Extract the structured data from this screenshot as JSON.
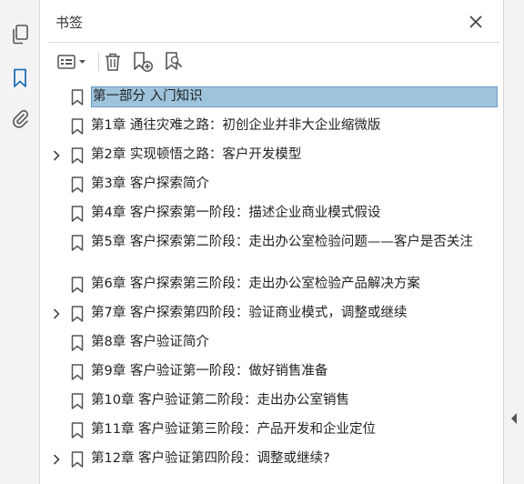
{
  "panel": {
    "title": "书签",
    "close_icon": "close-icon"
  },
  "rail": {
    "items": [
      {
        "name": "pages-icon",
        "active": false
      },
      {
        "name": "bookmark-icon",
        "active": true
      },
      {
        "name": "attachment-icon",
        "active": false
      }
    ]
  },
  "toolbar": {
    "buttons": [
      "options-menu-icon",
      "delete-icon",
      "new-bookmark-icon",
      "bookmark-search-icon"
    ]
  },
  "colors": {
    "accent": "#1f6fb5",
    "selected_bg": "#9ec3dc",
    "selected_border": "#6b9cc0"
  },
  "bookmarks": [
    {
      "label": "第一部分  入门知识",
      "expandable": false,
      "selected": true
    },
    {
      "label": "第1章  通往灾难之路：初创企业并非大企业缩微版",
      "expandable": false,
      "selected": false
    },
    {
      "label": "第2章  实现顿悟之路：客户开发模型",
      "expandable": true,
      "selected": false
    },
    {
      "label": "第3章  客户探索简介",
      "expandable": false,
      "selected": false
    },
    {
      "label": "第4章  客户探索第一阶段：描述企业商业模式假设",
      "expandable": false,
      "selected": false
    },
    {
      "label": "第5章  客户探索第二阶段：走出办公室检验问题——客户是否关注",
      "expandable": false,
      "selected": false
    },
    {
      "label": "第6章  客户探索第三阶段：走出办公室检验产品解决方案",
      "expandable": false,
      "selected": false
    },
    {
      "label": "第7章  客户探索第四阶段：验证商业模式，调整或继续",
      "expandable": true,
      "selected": false
    },
    {
      "label": "第8章  客户验证简介",
      "expandable": false,
      "selected": false
    },
    {
      "label": "第9章  客户验证第一阶段：做好销售准备",
      "expandable": false,
      "selected": false
    },
    {
      "label": "第10章  客户验证第二阶段：走出办公室销售",
      "expandable": false,
      "selected": false
    },
    {
      "label": "第11章  客户验证第三阶段：产品开发和企业定位",
      "expandable": false,
      "selected": false
    },
    {
      "label": "第12章  客户验证第四阶段：调整或继续?",
      "expandable": true,
      "selected": false
    }
  ]
}
